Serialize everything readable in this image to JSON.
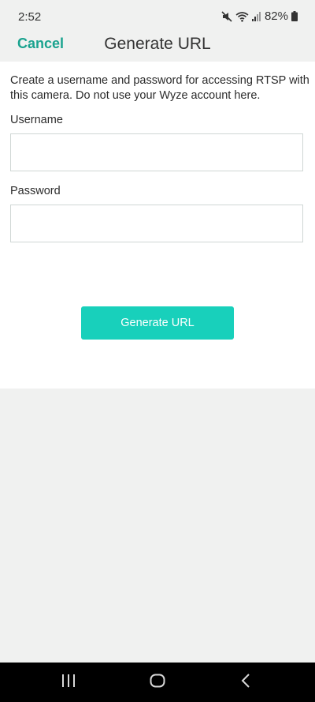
{
  "status_bar": {
    "time": "2:52",
    "battery": "82%"
  },
  "header": {
    "cancel_label": "Cancel",
    "title": "Generate URL"
  },
  "form": {
    "intro": "Create a username and password for accessing RTSP with this camera. Do not use your Wyze account here.",
    "username_label": "Username",
    "username_value": "",
    "password_label": "Password",
    "password_value": "",
    "submit_label": "Generate URL"
  },
  "colors": {
    "accent_text": "#1aa38f",
    "button_bg": "#18d0bb",
    "background": "#f0f1f0"
  },
  "icons": {
    "status": [
      "mute-icon",
      "wifi-icon",
      "signal-icon",
      "battery-icon"
    ],
    "android_nav": [
      "recent-apps-icon",
      "home-icon",
      "back-icon"
    ]
  }
}
